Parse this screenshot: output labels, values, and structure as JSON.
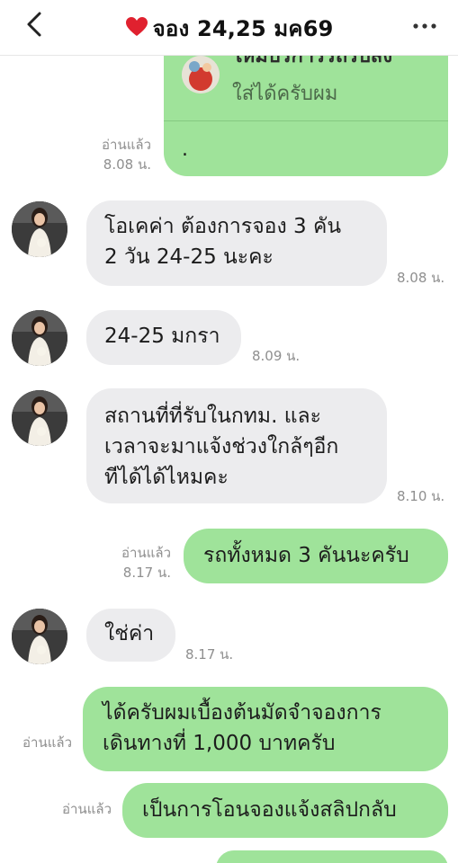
{
  "header": {
    "title": "จอง 24,25 มค69",
    "heart_icon": "heart-icon",
    "back_icon": "chevron-left-icon",
    "more_icon": "more-horizontal-icon",
    "heart_color": "#e0212f"
  },
  "top_card": {
    "title": "ใหม่บริการรถรับส่ง",
    "subtitle": "ใส่ได้ครับผม",
    "dot": ".",
    "read_label": "อ่านแล้ว",
    "time": "8.08 น."
  },
  "messages": [
    {
      "side": "in",
      "lines": [
        "โอเคค่า ต้องการจอง 3 คัน",
        "2 วัน 24-25 นะคะ"
      ],
      "time": "8.08 น."
    },
    {
      "side": "in",
      "lines": [
        "24-25 มกรา"
      ],
      "time": "8.09 น."
    },
    {
      "side": "in",
      "lines": [
        "สถานที่ที่รับในกทม. และ",
        "เวลาจะมาแจ้งช่วงใกล้ๆอีก",
        "ทีได้ได้ไหมคะ"
      ],
      "time": "8.10 น."
    },
    {
      "side": "out",
      "lines": [
        "รถทั้งหมด 3 คันนะครับ"
      ],
      "read": "อ่านแล้ว",
      "time": "8.17 น."
    },
    {
      "side": "in",
      "lines": [
        "ใช่ค่า"
      ],
      "time": "8.17 น."
    },
    {
      "side": "out",
      "lines": [
        "ได้ครับผมเบื้องต้นมัดจำจองการ",
        "เดินทางที่ 1,000 บาทครับ"
      ],
      "read": "อ่านแล้ว"
    },
    {
      "side": "out",
      "lines": [
        "เป็นการโอนจองแจ้งสลิปกลับ"
      ],
      "read": "อ่านแล้ว"
    }
  ],
  "colors": {
    "incoming_bubble": "#ececee",
    "outgoing_bubble": "#9fe39a",
    "meta_text": "#8f8f8f"
  }
}
